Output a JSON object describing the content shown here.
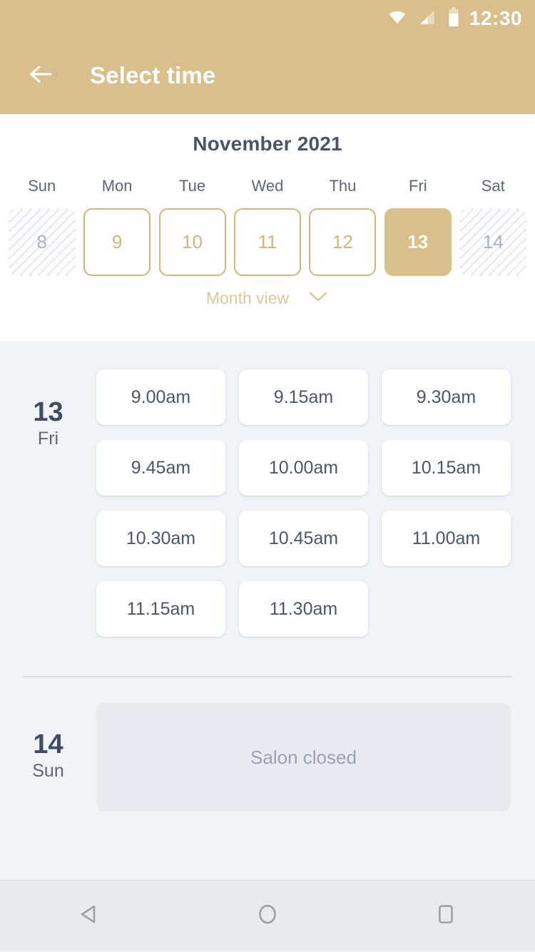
{
  "statusbar": {
    "clock": "12:30",
    "icons": [
      "wifi-icon",
      "cellular-signal-icon",
      "battery-icon"
    ]
  },
  "appbar": {
    "back_icon": "arrow-left-icon",
    "title": "Select time"
  },
  "calendar": {
    "month_title": "November 2021",
    "weekday_headers": [
      "Sun",
      "Mon",
      "Tue",
      "Wed",
      "Thu",
      "Fri",
      "Sat"
    ],
    "days": [
      {
        "number": "8",
        "state": "disabled"
      },
      {
        "number": "9",
        "state": "available"
      },
      {
        "number": "10",
        "state": "available"
      },
      {
        "number": "11",
        "state": "available"
      },
      {
        "number": "12",
        "state": "available"
      },
      {
        "number": "13",
        "state": "selected"
      },
      {
        "number": "14",
        "state": "disabled"
      }
    ],
    "month_view_label": "Month view",
    "month_view_icon": "chevron-down-icon"
  },
  "schedule": [
    {
      "day_number": "13",
      "day_name": "Fri",
      "slots": [
        "9.00am",
        "9.15am",
        "9.30am",
        "9.45am",
        "10.00am",
        "10.15am",
        "10.30am",
        "10.45am",
        "11.00am",
        "11.15am",
        "11.30am"
      ]
    },
    {
      "day_number": "14",
      "day_name": "Sun",
      "closed_message": "Salon closed"
    }
  ],
  "navbar": {
    "back_icon": "triangle-back-icon",
    "home_icon": "circle-home-icon",
    "recents_icon": "square-recents-icon"
  },
  "colors": {
    "brand": "#d8bf8c",
    "brand_border": "#d3b57e",
    "page_bg": "#f0f3f7",
    "panel_bg": "#ffffff",
    "text_dark": "#404c63",
    "text_muted": "#9aa3b3"
  }
}
